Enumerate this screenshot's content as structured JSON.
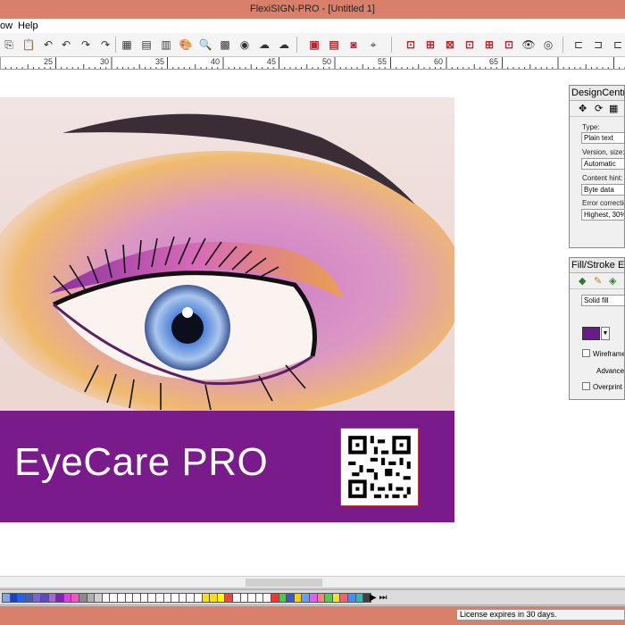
{
  "window": {
    "title": "FlexiSIGN-PRO - [Untitled 1]"
  },
  "menu": {
    "items": [
      "ow",
      "Help"
    ]
  },
  "ruler": {
    "ticks": [
      "25",
      "30",
      "35",
      "40",
      "45",
      "50",
      "55",
      "60",
      "65"
    ]
  },
  "artwork": {
    "brand_text": "EyeCare PRO",
    "banner_color": "#7a1b8b"
  },
  "design_central": {
    "title": "DesignCentral",
    "fields": [
      {
        "label": "Type:",
        "value": "Plain text"
      },
      {
        "label": "Version, size:",
        "value": "Automatic"
      },
      {
        "label": "Content hint:",
        "value": "Byte data"
      },
      {
        "label": "Error correction",
        "value": "Highest, 30%"
      }
    ]
  },
  "fill_stroke": {
    "title": "Fill/Stroke Ed",
    "fill_type": "Solid fill",
    "fill_color": "#6a1a8a",
    "wireframe_label": "Wireframe",
    "advanced_label": "Advanced",
    "overprint_label": "Overprint"
  },
  "palette": {
    "swatches": [
      "#7fa6e8",
      "#2040c0",
      "#2060ff",
      "#3b5fc8",
      "#7a64d8",
      "#6046c8",
      "#b060e8",
      "#8020c0",
      "#e040e0",
      "#ff50c8",
      "#8a8a8a",
      "#b0b0b0",
      "#d0d0d0",
      "#ffffff",
      "#ffffff",
      "#ffffff",
      "#ffffff",
      "#ffffff",
      "#ffffff",
      "#ffffff",
      "#ffffff",
      "#ffffff",
      "#ffffff",
      "#ffffff",
      "#ffffff",
      "#ffffff",
      "#ffe000",
      "#ffe000",
      "#ffff00",
      "#ff4040",
      "#ffffff",
      "#ffffff",
      "#ffffff",
      "#ffffff",
      "#ffffff",
      "#ff3030",
      "#40d040",
      "#3a5ad0",
      "#ffd000",
      "#60a0ff",
      "#e060ff",
      "#ff8080",
      "#50d050",
      "#ffe020",
      "#ff6060",
      "#4090ff",
      "#20c0c0",
      "#404040"
    ]
  },
  "status": {
    "license": "License expires in 30 days."
  }
}
